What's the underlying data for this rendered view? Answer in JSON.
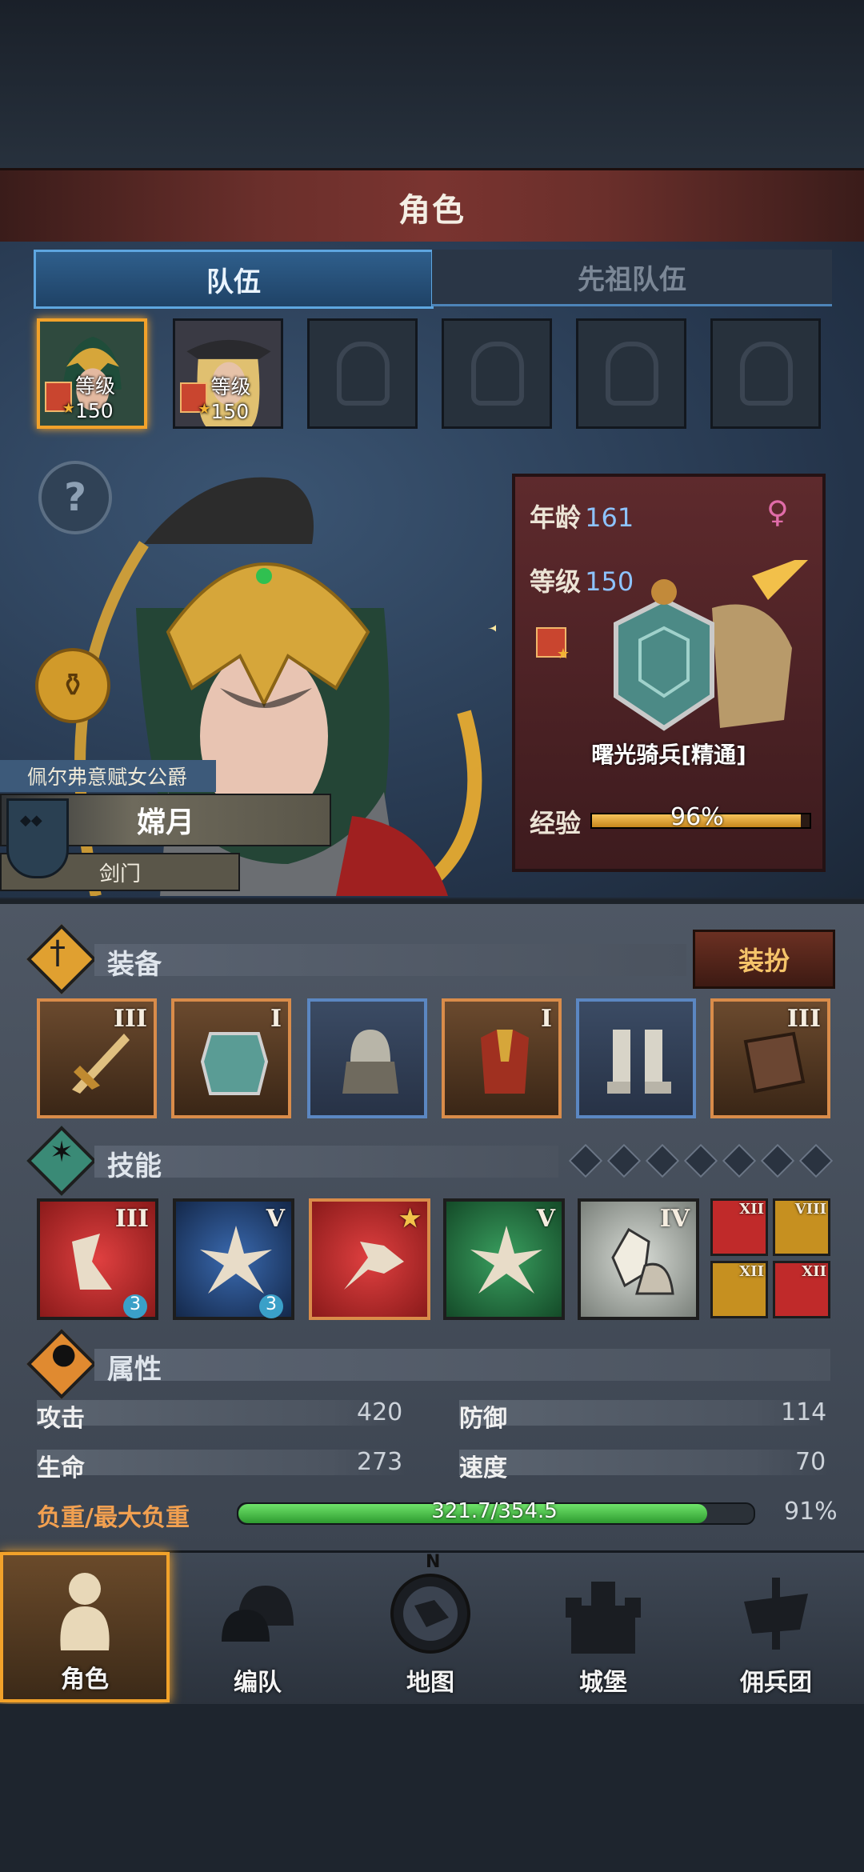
{
  "header": {
    "title": "角色"
  },
  "tabs": [
    {
      "label": "队伍"
    },
    {
      "label": "先祖队伍"
    }
  ],
  "team_slots": [
    {
      "level_label": "等级150"
    },
    {
      "level_label": "等级150"
    }
  ],
  "hero": {
    "title": "佩尔弗意赋女公爵",
    "name": "嫦月",
    "sect": "剑门",
    "help_symbol": "?"
  },
  "info": {
    "age_label": "年龄",
    "age": "161",
    "level_label": "等级",
    "level": "150",
    "unit": "曙光骑兵[精通]",
    "exp_label": "经验",
    "exp_percent": "96%",
    "exp_fraction": 0.96,
    "gender_symbol": "♀"
  },
  "equipment": {
    "title": "装备",
    "dress_button": "装扮",
    "items": [
      {
        "name": "sword",
        "rank": "III",
        "quality": "orange"
      },
      {
        "name": "shield",
        "rank": "I",
        "quality": "orange"
      },
      {
        "name": "helmet",
        "rank": "",
        "quality": "blue"
      },
      {
        "name": "armor",
        "rank": "I",
        "quality": "orange"
      },
      {
        "name": "boots",
        "rank": "",
        "quality": "blue"
      },
      {
        "name": "book",
        "rank": "III",
        "quality": "orange"
      }
    ]
  },
  "skills": {
    "title": "技能",
    "items": [
      {
        "rank": "III",
        "color": "#c02a2a",
        "badge": "3"
      },
      {
        "rank": "V",
        "color": "#2a4f8a",
        "badge": "3"
      },
      {
        "rank": "★",
        "color": "#c02a2a",
        "badge": ""
      },
      {
        "rank": "V",
        "color": "#2d7a45",
        "badge": ""
      },
      {
        "rank": "IV",
        "color": "#a8aea8",
        "badge": ""
      }
    ],
    "mini": [
      {
        "rank": "XII",
        "color": "#c02a2a"
      },
      {
        "rank": "VIII",
        "color": "#c69020"
      },
      {
        "rank": "XII",
        "color": "#c69020"
      },
      {
        "rank": "XII",
        "color": "#c02a2a"
      }
    ]
  },
  "attributes": {
    "title": "属性",
    "attack_label": "攻击",
    "attack": "420",
    "defense_label": "防御",
    "defense": "114",
    "hp_label": "生命",
    "hp": "273",
    "speed_label": "速度",
    "speed": "70",
    "load_label": "负重/最大负重",
    "load": "321.7/354.5",
    "load_percent": "91%",
    "load_fraction": 0.91
  },
  "nav": [
    {
      "label": "角色"
    },
    {
      "label": "编队"
    },
    {
      "label": "地图"
    },
    {
      "label": "城堡"
    },
    {
      "label": "佣兵团"
    }
  ],
  "compass_n": "N"
}
